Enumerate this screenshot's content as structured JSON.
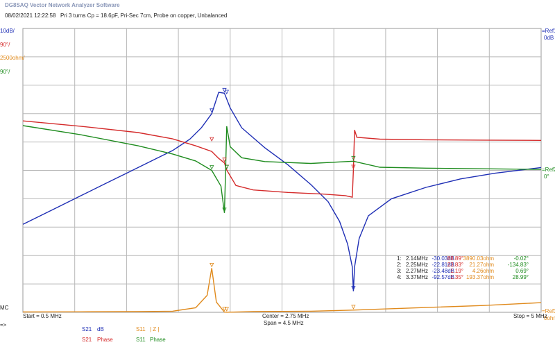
{
  "header": {
    "app_title": "DG8SAQ Vector Network Analyzer Software",
    "timestamp": "08/02/2021   12:22:58",
    "description": "Pri 3 turns Cp = 18.6pF, Pri-Sec 7cm, Probe on copper, Unbalanced"
  },
  "left_scale": {
    "s21_db": "10dB/",
    "s21_phase": "90°/",
    "s11_z": "2500ohm/",
    "s11_phase": "90°/",
    "mc": "MC",
    "arrows": "=>"
  },
  "right_refs": {
    "ref1": "=Ref1",
    "ref1_val": "0dB",
    "ref2": "=Ref2",
    "ref2_val": "0°",
    "ref3": "=Ref3",
    "ref3_val": "0ohm"
  },
  "x_axis": {
    "start": "Start = 0.5 MHz",
    "center": "Center = 2.75 MHz",
    "span": "Span = 4.5 MHz",
    "stop": "Stop = 5 MHz"
  },
  "legend": {
    "s21_db_code": "S21",
    "s21_db_unit": "dB",
    "s21_phase_code": "S21",
    "s21_phase_unit": "Phase",
    "s11_z_code": "S11",
    "s11_z_unit": "| Z |",
    "s11_phase_code": "S11",
    "s11_phase_unit": "Phase"
  },
  "markers": [
    {
      "id": "1:",
      "freq": "2.14MHz",
      "s21_db": "-30.03dB",
      "s21_phase": "88.89°",
      "s11_z": "3890.03ohm",
      "s11_phase": "-0.02°"
    },
    {
      "id": "2:",
      "freq": "2.25MHz",
      "s21_db": "-22.81dB",
      "s21_phase": "23.83°",
      "s11_z": "21.27ohm",
      "s11_phase": "-134.83°"
    },
    {
      "id": "3:",
      "freq": "2.27MHz",
      "s21_db": "-23.48dB",
      "s21_phase": "1.19°",
      "s11_z": "4.26ohm",
      "s11_phase": "0.69°"
    },
    {
      "id": "4:",
      "freq": "3.37MHz",
      "s21_db": "-92.57dB",
      "s21_phase": "1.35°",
      "s11_z": "193.37ohm",
      "s11_phase": "28.99°"
    }
  ],
  "colors": {
    "s21_db": "#1f2fb5",
    "s21_phase": "#d42a2a",
    "s11_z": "#e08a1c",
    "s11_phase": "#1f8c1f",
    "grid": "#b8b8b8"
  },
  "chart_data": {
    "type": "line",
    "x_unit": "MHz",
    "xlim": [
      0.5,
      5.0
    ],
    "grid": true,
    "series": [
      {
        "name": "S21 dB",
        "unit": "dB",
        "ylim": [
          -100,
          0
        ],
        "x": [
          0.5,
          0.8,
          0.9,
          1.0,
          1.2,
          1.4,
          1.6,
          1.8,
          1.95,
          2.05,
          2.14,
          2.2,
          2.25,
          2.3,
          2.4,
          2.6,
          2.8,
          3.0,
          3.15,
          3.25,
          3.32,
          3.36,
          3.37,
          3.38,
          3.42,
          3.5,
          3.7,
          4.0,
          4.3,
          4.6,
          5.0
        ],
        "y": [
          -69,
          -63,
          -61,
          -59,
          -55,
          -51,
          -47,
          -43,
          -39,
          -35,
          -30.03,
          -22.5,
          -22.81,
          -28,
          -35,
          -42,
          -48,
          -55,
          -61,
          -68,
          -76,
          -84,
          -92.57,
          -84,
          -74,
          -66,
          -60,
          -56,
          -53,
          -51,
          -49
        ]
      },
      {
        "name": "S21 Phase",
        "unit": "°",
        "ylim": [
          -450,
          450
        ],
        "x": [
          0.5,
          1.0,
          1.5,
          1.8,
          2.0,
          2.14,
          2.2,
          2.25,
          2.27,
          2.35,
          2.5,
          2.8,
          3.1,
          3.3,
          3.36,
          3.37,
          3.38,
          3.4,
          3.6,
          4.0,
          4.5,
          5.0
        ],
        "y": [
          157,
          140,
          120,
          100,
          78,
          60,
          38,
          23.83,
          1.19,
          -48,
          -62,
          -70,
          -75,
          -80,
          -85,
          1.35,
          128,
          105,
          99,
          97,
          96,
          95
        ]
      },
      {
        "name": "S11 |Z|",
        "unit": "ohm",
        "ylim": [
          0,
          25000
        ],
        "x": [
          0.5,
          1.0,
          1.5,
          1.8,
          2.0,
          2.1,
          2.14,
          2.18,
          2.25,
          2.27,
          2.5,
          3.0,
          3.37,
          3.6,
          4.0,
          4.5,
          5.0
        ],
        "y": [
          30,
          40,
          60,
          100,
          400,
          1500,
          3890.03,
          900,
          21.27,
          4.26,
          60,
          100,
          193.37,
          280,
          420,
          600,
          850
        ]
      },
      {
        "name": "S11 Phase",
        "unit": "°",
        "ylim": [
          -450,
          450
        ],
        "x": [
          0.5,
          1.0,
          1.5,
          1.8,
          2.0,
          2.14,
          2.22,
          2.25,
          2.26,
          2.27,
          2.3,
          2.4,
          2.6,
          3.0,
          3.37,
          3.6,
          4.0,
          4.5,
          5.0
        ],
        "y": [
          142,
          113,
          78,
          52,
          30,
          -0.02,
          -50,
          -134.83,
          0.69,
          140,
          75,
          40,
          28,
          22,
          28.99,
          10,
          7,
          5,
          3
        ]
      }
    ]
  }
}
